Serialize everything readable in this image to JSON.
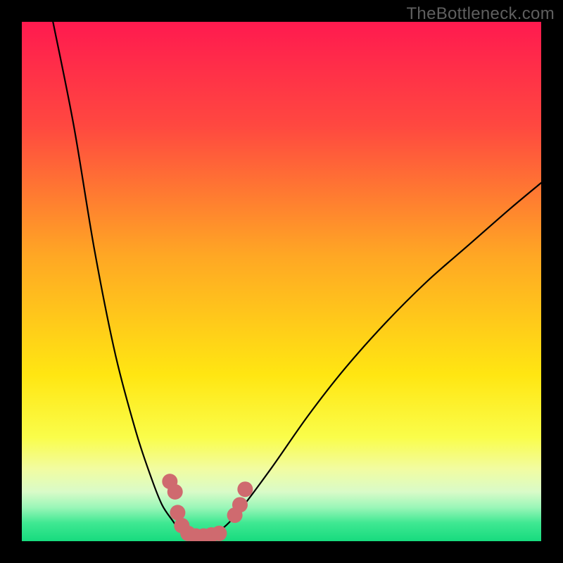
{
  "watermark": "TheBottleneck.com",
  "chart_data": {
    "type": "line",
    "title": "",
    "xlabel": "",
    "ylabel": "",
    "x_range": [
      0,
      100
    ],
    "y_range": [
      0,
      100
    ],
    "optimum_x": 33,
    "series": [
      {
        "name": "bottleneck-curve-left",
        "x": [
          6,
          10,
          14,
          18,
          22,
          25,
          27,
          29,
          30.5,
          32,
          33
        ],
        "values": [
          100,
          80,
          56,
          36,
          21,
          12,
          7,
          4,
          2,
          1,
          0
        ]
      },
      {
        "name": "bottleneck-curve-right",
        "x": [
          33,
          38,
          42,
          48,
          55,
          62,
          70,
          78,
          86,
          94,
          100
        ],
        "values": [
          0,
          2,
          6,
          14,
          24,
          33,
          42,
          50,
          57,
          64,
          69
        ]
      }
    ],
    "markers": {
      "name": "sample-points",
      "color": "#cf6a6f",
      "points": [
        {
          "x": 28.5,
          "y": 11.5
        },
        {
          "x": 29.5,
          "y": 9.5
        },
        {
          "x": 30.0,
          "y": 5.5
        },
        {
          "x": 30.8,
          "y": 3.0
        },
        {
          "x": 32.0,
          "y": 1.5
        },
        {
          "x": 33.5,
          "y": 1.0
        },
        {
          "x": 35.0,
          "y": 1.0
        },
        {
          "x": 36.5,
          "y": 1.2
        },
        {
          "x": 38.0,
          "y": 1.5
        },
        {
          "x": 41.0,
          "y": 5.0
        },
        {
          "x": 42.0,
          "y": 7.0
        },
        {
          "x": 43.0,
          "y": 10.0
        }
      ]
    },
    "background_gradient": {
      "type": "vertical",
      "stops": [
        {
          "pos": 0.0,
          "color": "#ff1a4f"
        },
        {
          "pos": 0.2,
          "color": "#ff4840"
        },
        {
          "pos": 0.45,
          "color": "#ffa724"
        },
        {
          "pos": 0.68,
          "color": "#ffe612"
        },
        {
          "pos": 0.8,
          "color": "#fafd4a"
        },
        {
          "pos": 0.86,
          "color": "#f2fca0"
        },
        {
          "pos": 0.905,
          "color": "#d9fbc8"
        },
        {
          "pos": 0.935,
          "color": "#9af6b8"
        },
        {
          "pos": 0.965,
          "color": "#3fe892"
        },
        {
          "pos": 1.0,
          "color": "#17db7e"
        }
      ]
    }
  }
}
